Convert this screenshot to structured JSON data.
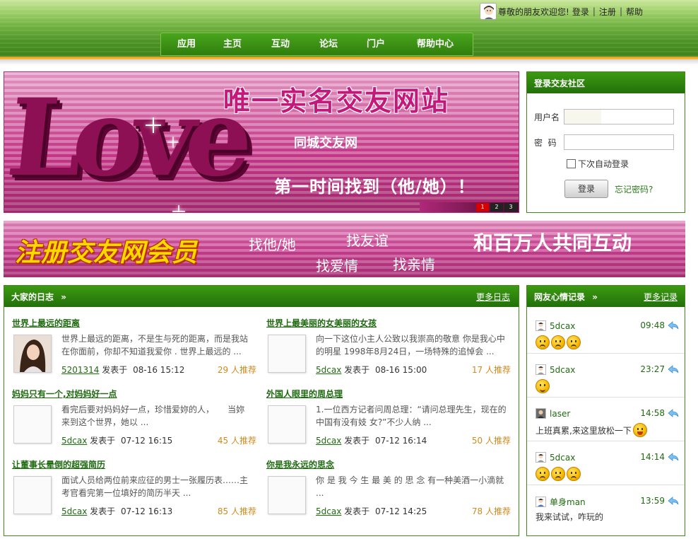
{
  "topbar": {
    "welcome": "尊敬的朋友欢迎您!",
    "login": "登录",
    "register": "注册",
    "help": "帮助",
    "sep": "|"
  },
  "nav": [
    "应用",
    "主页",
    "互动",
    "论坛",
    "门户",
    "帮助中心"
  ],
  "banner": {
    "love_word": "Love",
    "title": "唯一实名交友网站",
    "subtitle": "同城交友网",
    "slogan": "第一时间找到（他/她）！",
    "slides": [
      "1",
      "2",
      "3"
    ]
  },
  "login_box": {
    "title": "登录交友社区",
    "username_label": "用户名",
    "password_label": "密  码",
    "remember_label": "下次自动登录",
    "submit_label": "登录",
    "forgot_label": "忘记密码?"
  },
  "reg_banner": {
    "title": "注册交友网会员",
    "kw1": "找他/她",
    "kw2": "找友谊",
    "kw3": "找爱情",
    "kw4": "找亲情",
    "slogan": "和百万人共同互动"
  },
  "diary": {
    "title": "大家的日志",
    "arrow": "»",
    "more": "更多日志",
    "entries": [
      {
        "title": "世界上最远的距离",
        "excerpt": "世界上最远的距离，不是生与死的距离，而是我站在你面前，你却不知道我爱你 . 世界上最远的 ...",
        "author": "5201314",
        "posted": "发表于",
        "date": "08-16 15:12",
        "recommend": "29 人推荐"
      },
      {
        "title": "世界上最美丽的女美丽的女孩",
        "excerpt": "向一下这位小主人公致以我崇高的敬意 你是我心中的明星 1998年8月24日，一场特殊的追悼会 ...",
        "author": "5dcax",
        "posted": "发表于",
        "date": "08-16 15:00",
        "recommend": "17 人推荐"
      },
      {
        "title": "妈妈只有一个,对妈妈好一点",
        "excerpt": "看完后要对妈妈好一点，珍惜爱妳的人，     当妳来到这个世界，她以 ...",
        "author": "5dcax",
        "posted": "发表于",
        "date": "07-12 16:15",
        "recommend": "45 人推荐"
      },
      {
        "title": "外国人眼里的周总理",
        "excerpt": "1.一位西方记者问周总理：“请问总理先生，现在的中国有没有妓 女?”不少人纳 ...",
        "author": "5dcax",
        "posted": "发表于",
        "date": "07-12 16:14",
        "recommend": "50 人推荐"
      },
      {
        "title": "让董事长晕倒的超强简历",
        "excerpt": "面试人员给两位前来应征的男士一张履历表……主考官看完第一位填好的简历半天 ...",
        "author": "5dcax",
        "posted": "发表于",
        "date": "07-12 16:13",
        "recommend": "85 人推荐"
      },
      {
        "title": "你是我永远的思念",
        "excerpt": "你 是 我 今 生 最 美 的 思 念 有一种美酒一小滴就 ...",
        "author": "5dcax",
        "posted": "发表于",
        "date": "07-12 14:25",
        "recommend": "78 人推荐"
      }
    ]
  },
  "mood": {
    "title": "网友心情记录",
    "arrow": "»",
    "more": "更多记录",
    "items": [
      {
        "user": "5dcax",
        "time": "09:48",
        "text": ""
      },
      {
        "user": "5dcax",
        "time": "23:27",
        "text": ""
      },
      {
        "user": "laser",
        "time": "14:58",
        "text": "上班真累,来这里放松一下"
      },
      {
        "user": "5dcax",
        "time": "14:14",
        "text": ""
      },
      {
        "user": "单身man",
        "time": "13:59",
        "text": "我来试试，咋玩的"
      }
    ]
  }
}
